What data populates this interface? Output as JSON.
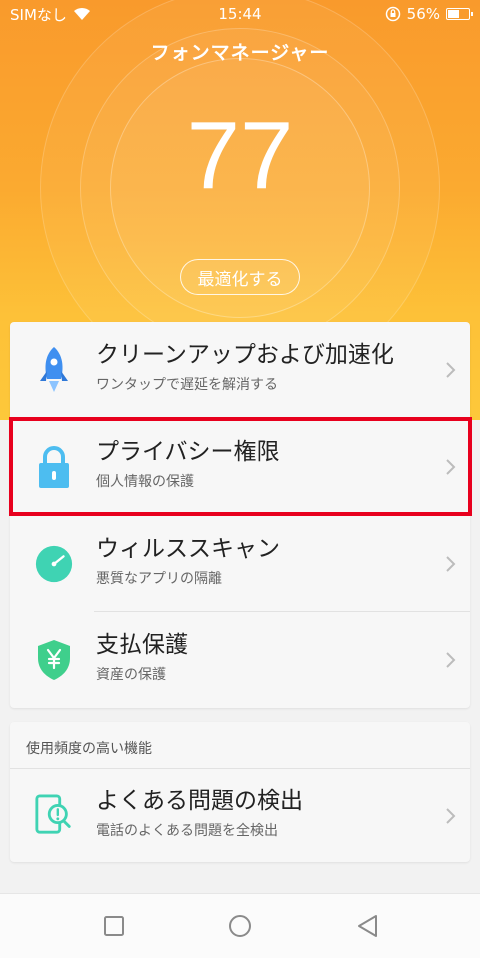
{
  "status_bar": {
    "carrier": "SIMなし",
    "time": "15:44",
    "battery": "56%",
    "battery_level": 0.56
  },
  "header": {
    "title": "フォンマネージャー",
    "score": "77",
    "optimize_label": "最適化する"
  },
  "features": [
    {
      "title": "クリーンアップおよび加速化",
      "subtitle": "ワンタップで遅延を解消する",
      "icon": "rocket-icon"
    },
    {
      "title": "プライバシー権限",
      "subtitle": "個人情報の保護",
      "icon": "lock-icon"
    },
    {
      "title": "ウィルススキャン",
      "subtitle": "悪質なアプリの隔離",
      "icon": "scan-clock-icon"
    },
    {
      "title": "支払保護",
      "subtitle": "資産の保護",
      "icon": "yen-shield-icon"
    }
  ],
  "frequent": {
    "header": "使用頻度の高い機能",
    "items": [
      {
        "title": "よくある問題の検出",
        "subtitle": "電話のよくある問題を全検出",
        "icon": "phone-diagnose-icon"
      }
    ]
  },
  "colors": {
    "hero_top": "#f99a2c",
    "hero_bottom": "#fdc83a",
    "highlight": "#e8001e",
    "rocket": "#3f8ff0",
    "lock": "#4dbdf0",
    "scan": "#3fd3b3",
    "shield": "#3fcf8c"
  }
}
